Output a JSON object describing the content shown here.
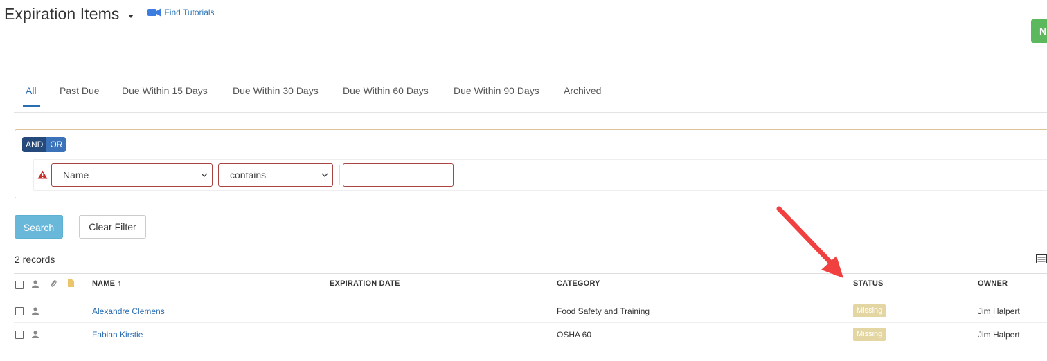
{
  "header": {
    "title": "Expiration Items",
    "tutorials_label": "Find Tutorials"
  },
  "new_button_label": "N",
  "tabs": [
    {
      "label": "All",
      "active": true
    },
    {
      "label": "Past Due"
    },
    {
      "label": "Due Within 15 Days"
    },
    {
      "label": "Due Within 30 Days"
    },
    {
      "label": "Due Within 60 Days"
    },
    {
      "label": "Due Within 90 Days"
    },
    {
      "label": "Archived"
    }
  ],
  "filter": {
    "and_label": "AND",
    "or_label": "OR",
    "field_value": "Name",
    "operator_value": "contains",
    "value": ""
  },
  "actions": {
    "search_label": "Search",
    "clear_label": "Clear Filter"
  },
  "records_label": "2 records",
  "table": {
    "columns": {
      "name": "NAME ↑",
      "expiration_date": "EXPIRATION DATE",
      "category": "CATEGORY",
      "status": "STATUS",
      "owner": "OWNER"
    },
    "rows": [
      {
        "name": "Alexandre Clemens",
        "expiration_date": "",
        "category": "Food Safety and Training",
        "status": "Missing",
        "owner": "Jim Halpert"
      },
      {
        "name": "Fabian Kirstie",
        "expiration_date": "",
        "category": "OSHA 60",
        "status": "Missing",
        "owner": "Jim Halpert"
      }
    ]
  },
  "colors": {
    "accent": "#2a6db3",
    "new_button": "#5cb85c",
    "search_button": "#69b8d9",
    "status_missing": "#e3d6a2",
    "annotation_arrow": "#f04040"
  },
  "icons": {
    "tutorials": "video-camera-icon",
    "row_owner": "user-icon",
    "header_attachment": "paperclip-icon",
    "header_note": "document-icon",
    "rule_warning": "warning-triangle-icon",
    "column_toggle": "list-icon"
  }
}
